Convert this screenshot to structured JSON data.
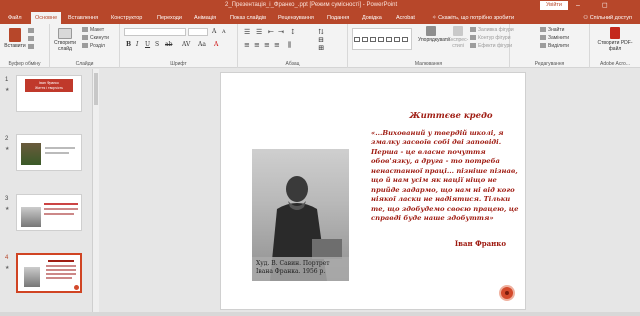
{
  "window": {
    "title": "2_Презентація_і_Франко_.ppt  [Режим сумісності]  -  PowerPoint",
    "signin_label": "Увійти",
    "controls": "–  ◻  ✕"
  },
  "tabs": {
    "items": [
      "Файл",
      "Основне",
      "Вставлення",
      "Конструктор",
      "Переходи",
      "Анімація",
      "Показ слайдів",
      "Рецензування",
      "Подання",
      "Довідка",
      "Acrobat"
    ],
    "active": "Основне",
    "tell_me": "Скажіть, що потрібно зробити",
    "share": "Спільний доступ"
  },
  "ribbon": {
    "clipboard": {
      "paste": "Вставити",
      "label": "Буфер обміну"
    },
    "slides": {
      "new_slide": "Створити слайд",
      "layout": "Макет",
      "reset": "Скинути",
      "section": "Розділ",
      "label": "Слайди"
    },
    "font": {
      "label": "Шрифт",
      "font_name": "",
      "font_size": ""
    },
    "paragraph": {
      "label": "Абзац"
    },
    "drawing": {
      "arrange": "Упорядкувати",
      "quick_styles": "Експрес-стилі",
      "fill": "Заливка фігури",
      "outline": "Контур фігури",
      "effects": "Ефекти фігури",
      "label": "Малювання"
    },
    "editing": {
      "find": "Знайти",
      "replace": "Замінити",
      "select": "Виділити",
      "label": "Редагування"
    },
    "acrobat": {
      "create_pdf": "Створити PDF-файл",
      "label": "Adobe Acro..."
    }
  },
  "thumbnails": [
    {
      "number": "1",
      "title_line1": "Іван Франко",
      "title_line2": "Життя і творчість"
    },
    {
      "number": "2"
    },
    {
      "number": "3"
    },
    {
      "number": "4",
      "selected": true
    }
  ],
  "slide": {
    "heading": "Життєве кредо",
    "quote": "«...Вихований у твердій школі, я змалку засвоїв собі дві заповіді. Перша - це власне почуття обов'язку, а друга - то потреба ненастанної праці... пізніше пізнав, що й нам усім як нації ніщо не прийде задармо, що нам ні від кого ніякої ласки не надіятися. Тільки те, що здобудемо своєю працею, це справді буде наше здобуття»",
    "author": "Іван Франко",
    "photo_caption_1": "Худ. В. Савин. Портрет",
    "photo_caption_2": "Івана Франка. 1956 р."
  },
  "colors": {
    "accent": "#b7472a",
    "quote_red": "#9e1a10"
  }
}
